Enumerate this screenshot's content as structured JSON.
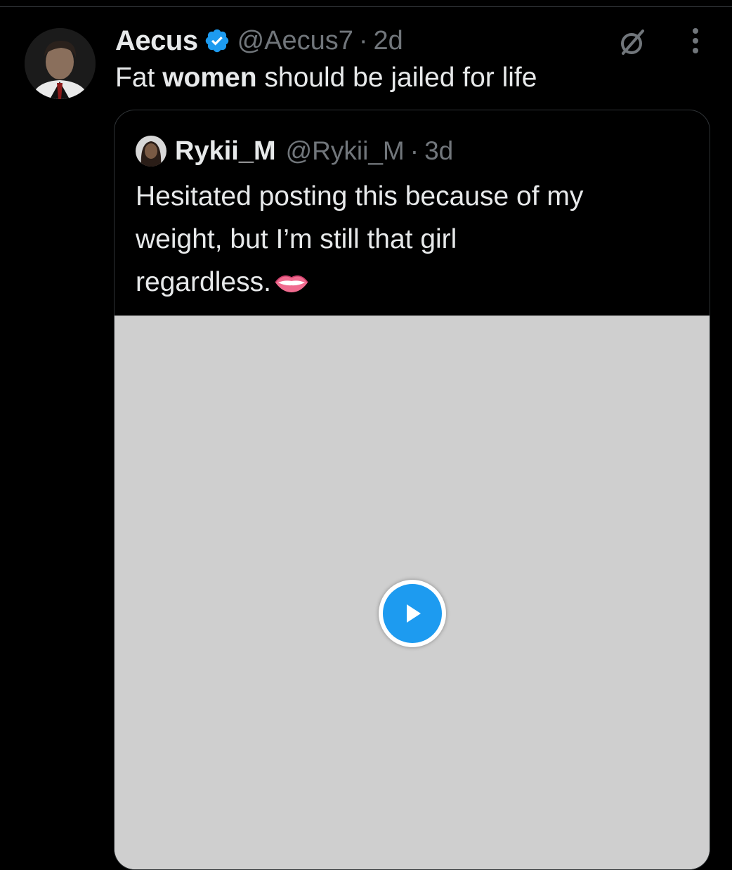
{
  "tweet": {
    "author": {
      "display_name": "Aecus",
      "handle": "@Aecus7",
      "verified": true,
      "avatar_icon": "portrait-avatar"
    },
    "time": "2d",
    "separator": "·",
    "text_before": "Fat ",
    "text_bold": "women",
    "text_after": " should be jailed for life",
    "icons": {
      "grok": "grok-icon",
      "more": "more-vertical-icon"
    }
  },
  "quoted_tweet": {
    "author": {
      "display_name": "Rykii_M",
      "handle": "@Rykii_M",
      "avatar_icon": "portrait-avatar"
    },
    "time": "3d",
    "separator": "·",
    "text_lines": [
      "Hesitated posting this because of my",
      "weight, but I’m still that girl",
      "regardless."
    ],
    "emoji_icon": "lips-emoji",
    "media": {
      "type": "video",
      "play_icon": "play-icon"
    }
  },
  "colors": {
    "background": "#000000",
    "text_primary": "#e7e9ea",
    "text_secondary": "#71767b",
    "accent": "#1d9bf0",
    "border": "#2f3336"
  }
}
